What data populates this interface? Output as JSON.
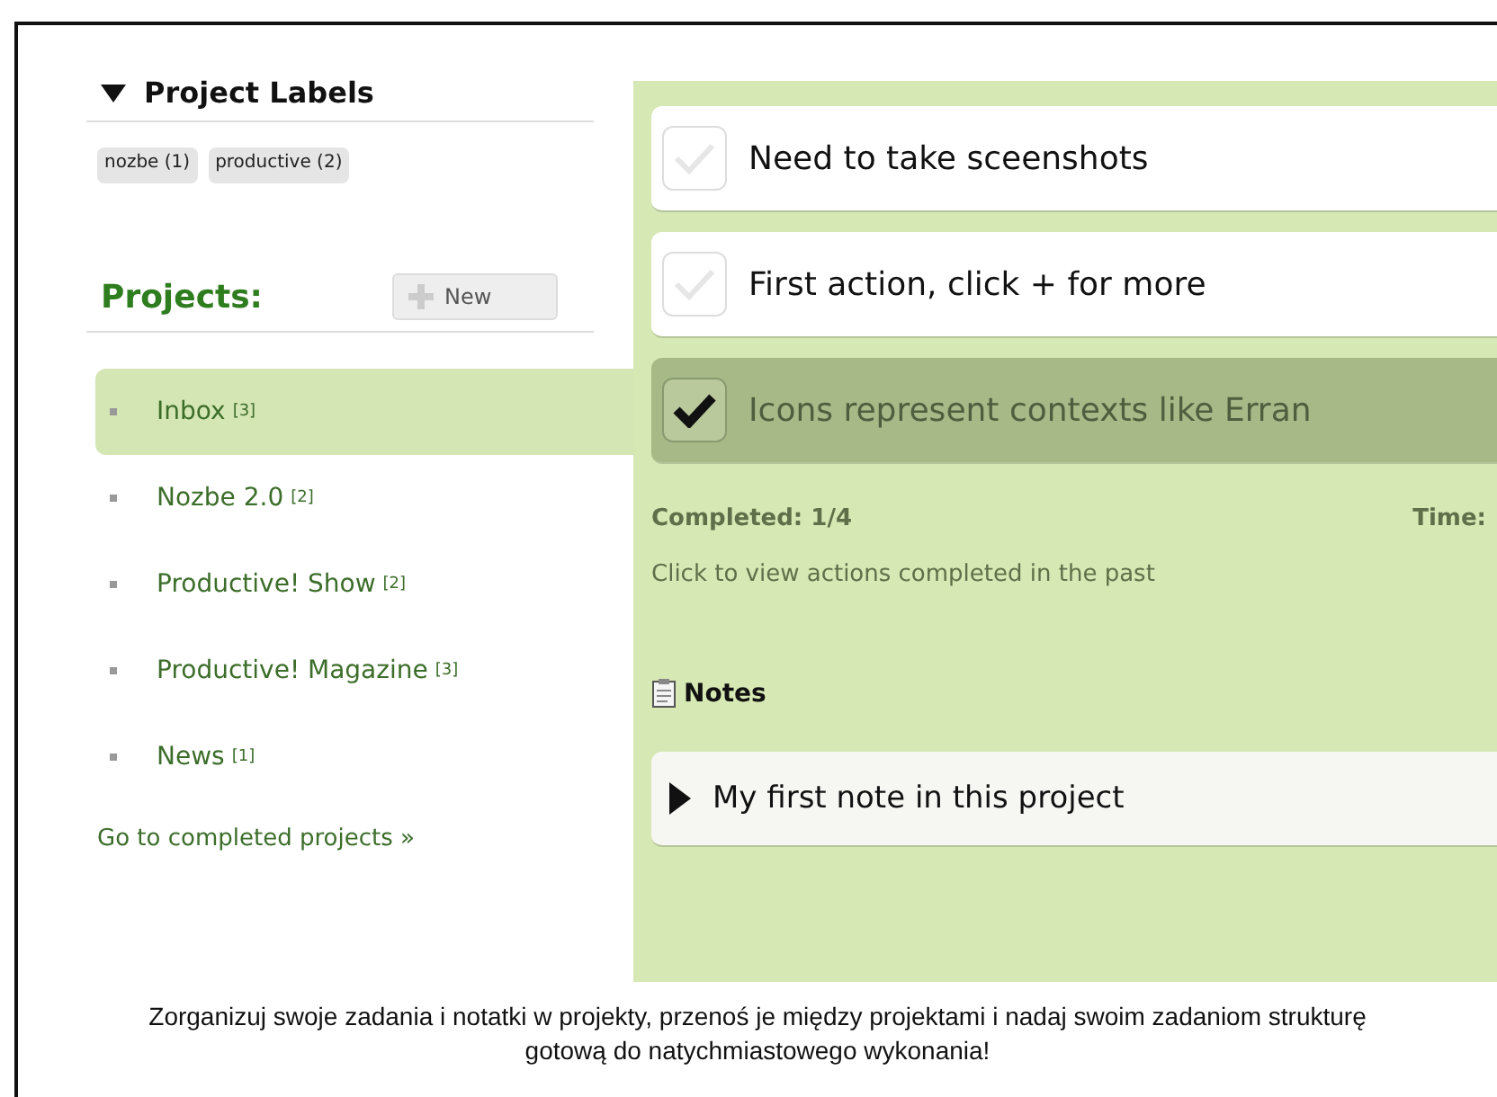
{
  "labels_section": {
    "title": "Project Labels",
    "expanded": true,
    "labels": [
      {
        "text": "nozbe (1)"
      },
      {
        "text": "productive (2)"
      }
    ]
  },
  "projects_section": {
    "title": "Projects:",
    "new_button": "New",
    "projects": [
      {
        "name": "Inbox",
        "count": "[3]",
        "selected": true
      },
      {
        "name": "Nozbe 2.0",
        "count": "[2]",
        "selected": false
      },
      {
        "name": "Productive! Show",
        "count": "[2]",
        "selected": false
      },
      {
        "name": "Productive! Magazine",
        "count": "[3]",
        "selected": false
      },
      {
        "name": "News",
        "count": "[1]",
        "selected": false
      }
    ],
    "completed_link": "Go to completed projects »"
  },
  "tasks": [
    {
      "text": "Need to take sceenshots",
      "checked": false
    },
    {
      "text": "First action, click + for more",
      "checked": false
    },
    {
      "text": "Icons represent contexts like Erran",
      "checked": true
    }
  ],
  "summary": {
    "completed": "Completed: 1/4",
    "time": "Time:"
  },
  "past_link": "Click to view actions completed in the past",
  "notes": {
    "title": "Notes",
    "items": [
      {
        "text": "My first note in this project",
        "expanded": false
      }
    ]
  },
  "caption": "Zorganizuj swoje zadania i notatki w projekty, przenoś je między projektami i nadaj swoim zadaniom strukturę gotową do natychmiastowego wykonania!"
}
